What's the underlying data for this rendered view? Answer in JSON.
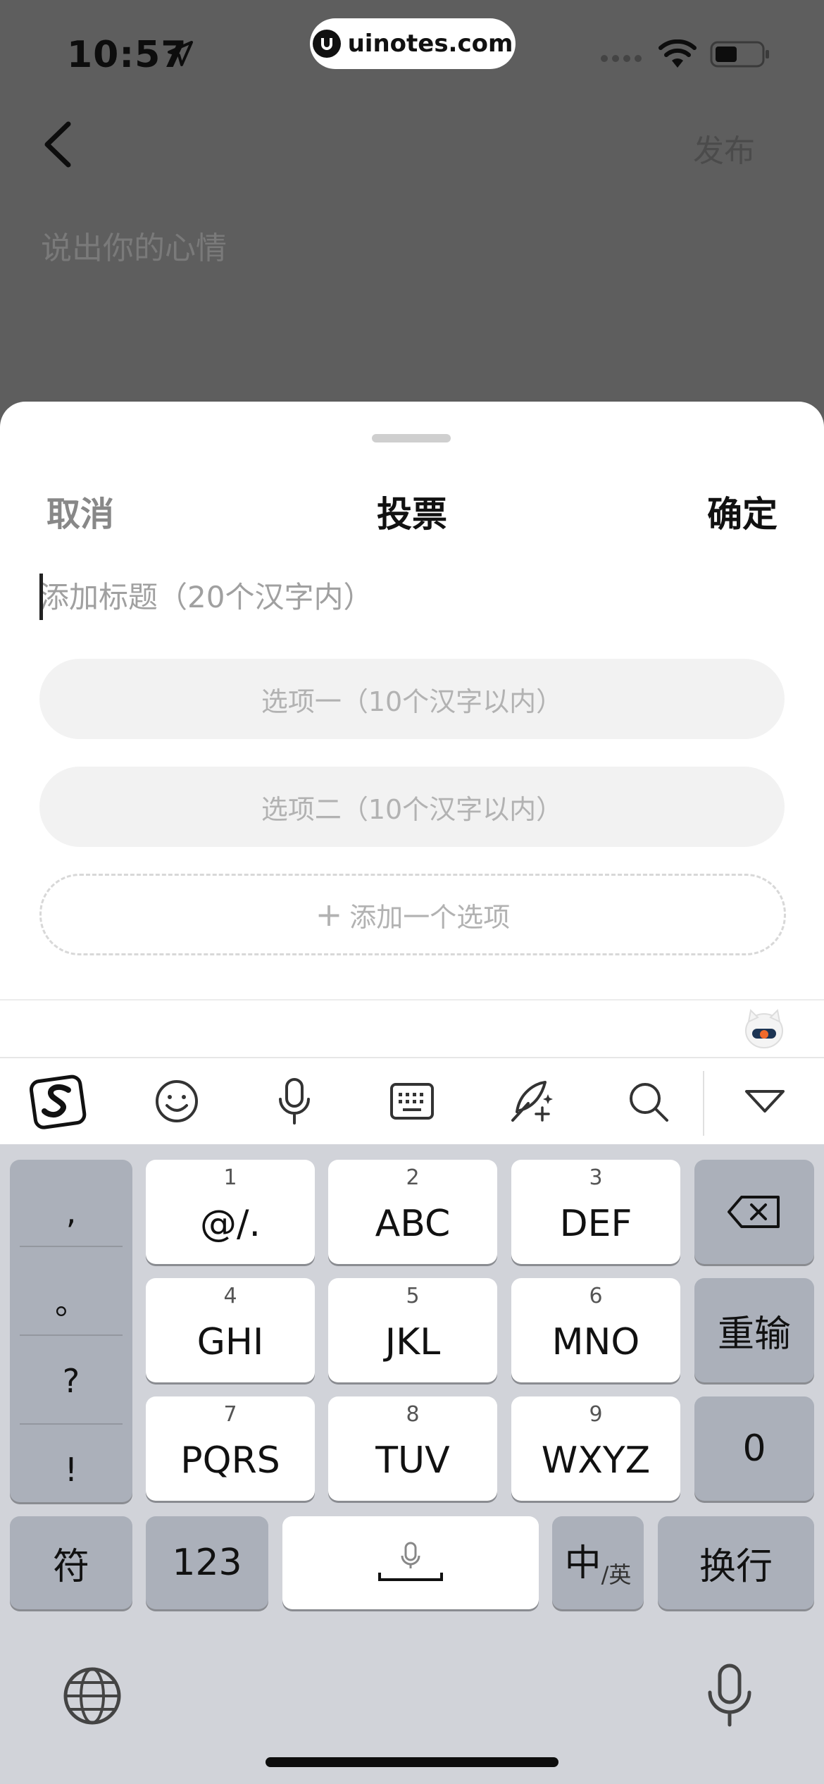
{
  "status_bar": {
    "time": "10:57",
    "watermark": "uinotes.com"
  },
  "page": {
    "publish_label": "发布",
    "mood_placeholder": "说出你的心情"
  },
  "sheet": {
    "cancel_label": "取消",
    "title": "投票",
    "confirm_label": "确定",
    "title_placeholder": "添加标题（20个汉字内）",
    "option1_placeholder": "选项一（10个汉字以内）",
    "option2_placeholder": "选项二（10个汉字以内）",
    "add_option_label": "添加一个选项"
  },
  "toolbar_icons": [
    "sogou-logo-icon",
    "emoji-icon",
    "microphone-icon",
    "keyboard-icon",
    "handwriting-icon",
    "search-icon",
    "collapse-icon"
  ],
  "keyboard": {
    "punctuation": [
      ",",
      "。",
      "?",
      "!"
    ],
    "keys": [
      {
        "num": "1",
        "label": "@/."
      },
      {
        "num": "2",
        "label": "ABC"
      },
      {
        "num": "3",
        "label": "DEF"
      },
      {
        "num": "4",
        "label": "GHI"
      },
      {
        "num": "5",
        "label": "JKL"
      },
      {
        "num": "6",
        "label": "MNO"
      },
      {
        "num": "7",
        "label": "PQRS"
      },
      {
        "num": "8",
        "label": "TUV"
      },
      {
        "num": "9",
        "label": "WXYZ"
      }
    ],
    "reenter_label": "重输",
    "zero_label": "0",
    "symbols_label": "符",
    "numbers_label": "123",
    "lang_main": "中",
    "lang_alt": "/英",
    "newline_label": "换行"
  }
}
